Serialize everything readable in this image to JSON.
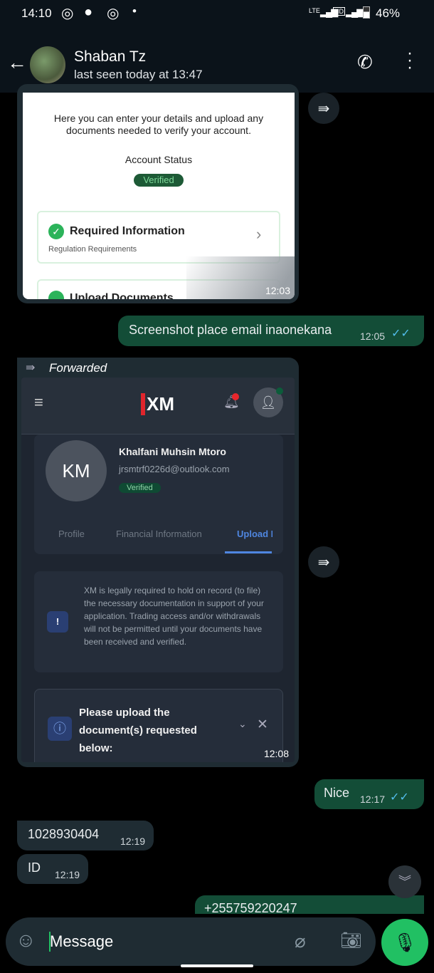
{
  "status_bar": {
    "time": "14:10",
    "battery": "46%",
    "network": "LTE",
    "hd": "HD"
  },
  "header": {
    "contact_name": "Shaban Tz",
    "last_seen": "last seen today at 13:47"
  },
  "messages": [
    {
      "type": "image",
      "direction": "in",
      "time": "12:03",
      "content": {
        "intro": "Here you can enter your details and upload any documents needed to verify your account.",
        "account_status_label": "Account Status",
        "status_badge": "Verified",
        "card_title": "Required Information",
        "card_subtitle": "Regulation Requirements",
        "next_card_title": "Upload Documents"
      }
    },
    {
      "type": "text",
      "direction": "out",
      "text": "Screenshot place email inaonekana",
      "time": "12:05",
      "read": true
    },
    {
      "type": "image",
      "direction": "in",
      "forwarded_label": "Forwarded",
      "time": "12:08",
      "content": {
        "logo": "XM",
        "initials": "KM",
        "name": "Khalfani Muhsin Mtoro",
        "email": "jrsmtrf0226d@outlook.com",
        "badge": "Verified",
        "tabs": [
          "Profile",
          "Financial Information",
          "Upload D"
        ],
        "active_tab": 2,
        "notice": "XM is legally required to hold on record (to file) the necessary documentation in support of your application. Trading access and/or withdrawals will not be permitted until your documents have been received and verified.",
        "upload_title": "Please upload the document(s) requested below:"
      }
    },
    {
      "type": "text",
      "direction": "out",
      "text": "Nice",
      "time": "12:17",
      "read": true
    },
    {
      "type": "text",
      "direction": "in",
      "text": "1028930404",
      "time": "12:19"
    },
    {
      "type": "text",
      "direction": "in",
      "text": "ID",
      "time": "12:19"
    },
    {
      "type": "text",
      "direction": "out",
      "text": "+255759220247"
    }
  ],
  "composer": {
    "placeholder": "Message"
  },
  "colors": {
    "accent": "#21c063",
    "out_bubble": "#134d37",
    "in_bubble": "#1f2c33",
    "read_ticks": "#53bdeb"
  }
}
